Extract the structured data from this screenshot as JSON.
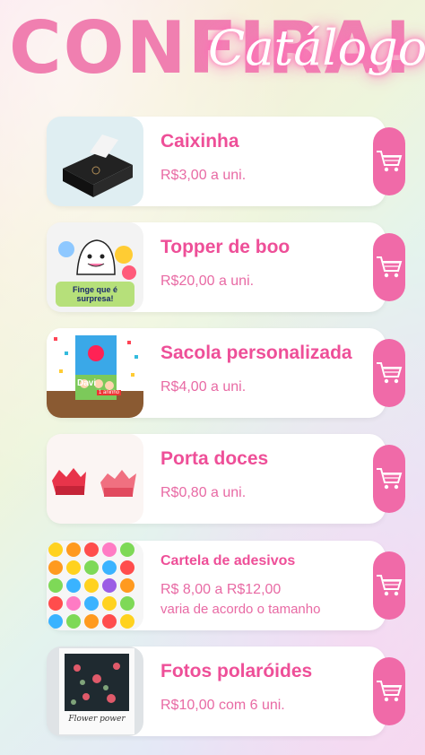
{
  "header": {
    "headline": "CONFIRA!",
    "script_title": "Catálogo"
  },
  "products": [
    {
      "title": "Caixinha",
      "price": "R$3,00 a uni."
    },
    {
      "title": "Topper de boo",
      "price": "R$20,00 a uni.",
      "image_text": "Finge que é surpresa!"
    },
    {
      "title": "Sacola personalizada",
      "price": "R$4,00 a uni.",
      "image_text": "Davi",
      "image_subtext": "1 aninho"
    },
    {
      "title": "Porta doces",
      "price": "R$0,80 a uni."
    },
    {
      "title": "Cartela de adesivos",
      "price": "R$ 8,00 a R$12,00",
      "price_note": "varia de acordo o tamanho"
    },
    {
      "title": "Fotos polaróides",
      "price": "R$10,00 com 6 uni.",
      "image_text": "Flower power"
    }
  ],
  "colors": {
    "accent": "#ee4f98",
    "cart_button": "#f06aa8",
    "headline": "#f07fb0"
  },
  "icons": {
    "cart": "shopping-cart-icon"
  }
}
